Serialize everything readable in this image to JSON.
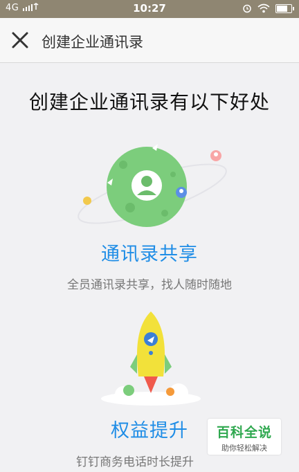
{
  "status_bar": {
    "network": "4G",
    "time": "10:27"
  },
  "app_bar": {
    "title": "创建企业通讯录",
    "close_icon": "close-icon"
  },
  "headline": "创建企业通讯录有以下好处",
  "features": [
    {
      "title": "通讯录共享",
      "description": "全员通讯录共享，找人随时随地",
      "icon": "planet-contact-icon"
    },
    {
      "title": "权益提升",
      "description": "钉钉商务电话时长提升",
      "icon": "rocket-icon"
    }
  ],
  "watermark": {
    "logo": "百科全说",
    "subtitle": "助你轻松解决"
  },
  "colors": {
    "status_bar": "#8f8672",
    "accent": "#1f8de6",
    "planet": "#7ccd7c",
    "rocket": "#f2e13a"
  }
}
